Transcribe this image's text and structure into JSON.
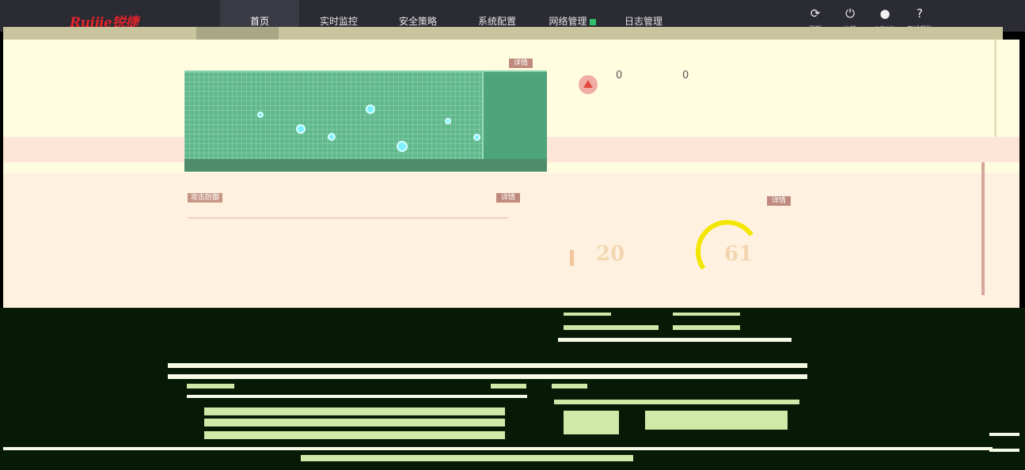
{
  "brand": {
    "logo_text": "Ruijie锐捷"
  },
  "nav": {
    "items": [
      {
        "label": "首页",
        "active": true
      },
      {
        "label": "实时监控"
      },
      {
        "label": "安全策略"
      },
      {
        "label": "系统配置"
      },
      {
        "label": "网络管理"
      },
      {
        "label": "日志管理"
      }
    ]
  },
  "toolbar": {
    "refresh": "刷新",
    "logout": "注销",
    "user": "admin",
    "help": "在线帮助"
  },
  "panels": {
    "topology": {
      "detail": "详情"
    },
    "alerts": {
      "count_a": "0",
      "count_b": "0"
    },
    "threats": {
      "tag": "攻击防御",
      "detail": "详情"
    },
    "usage": {
      "detail": "详情",
      "value_a": "20",
      "value_b": "61"
    }
  },
  "colors": {
    "accent": "#e0242b",
    "nav_bg": "#2b2b33",
    "gauge": "#f3e600"
  }
}
